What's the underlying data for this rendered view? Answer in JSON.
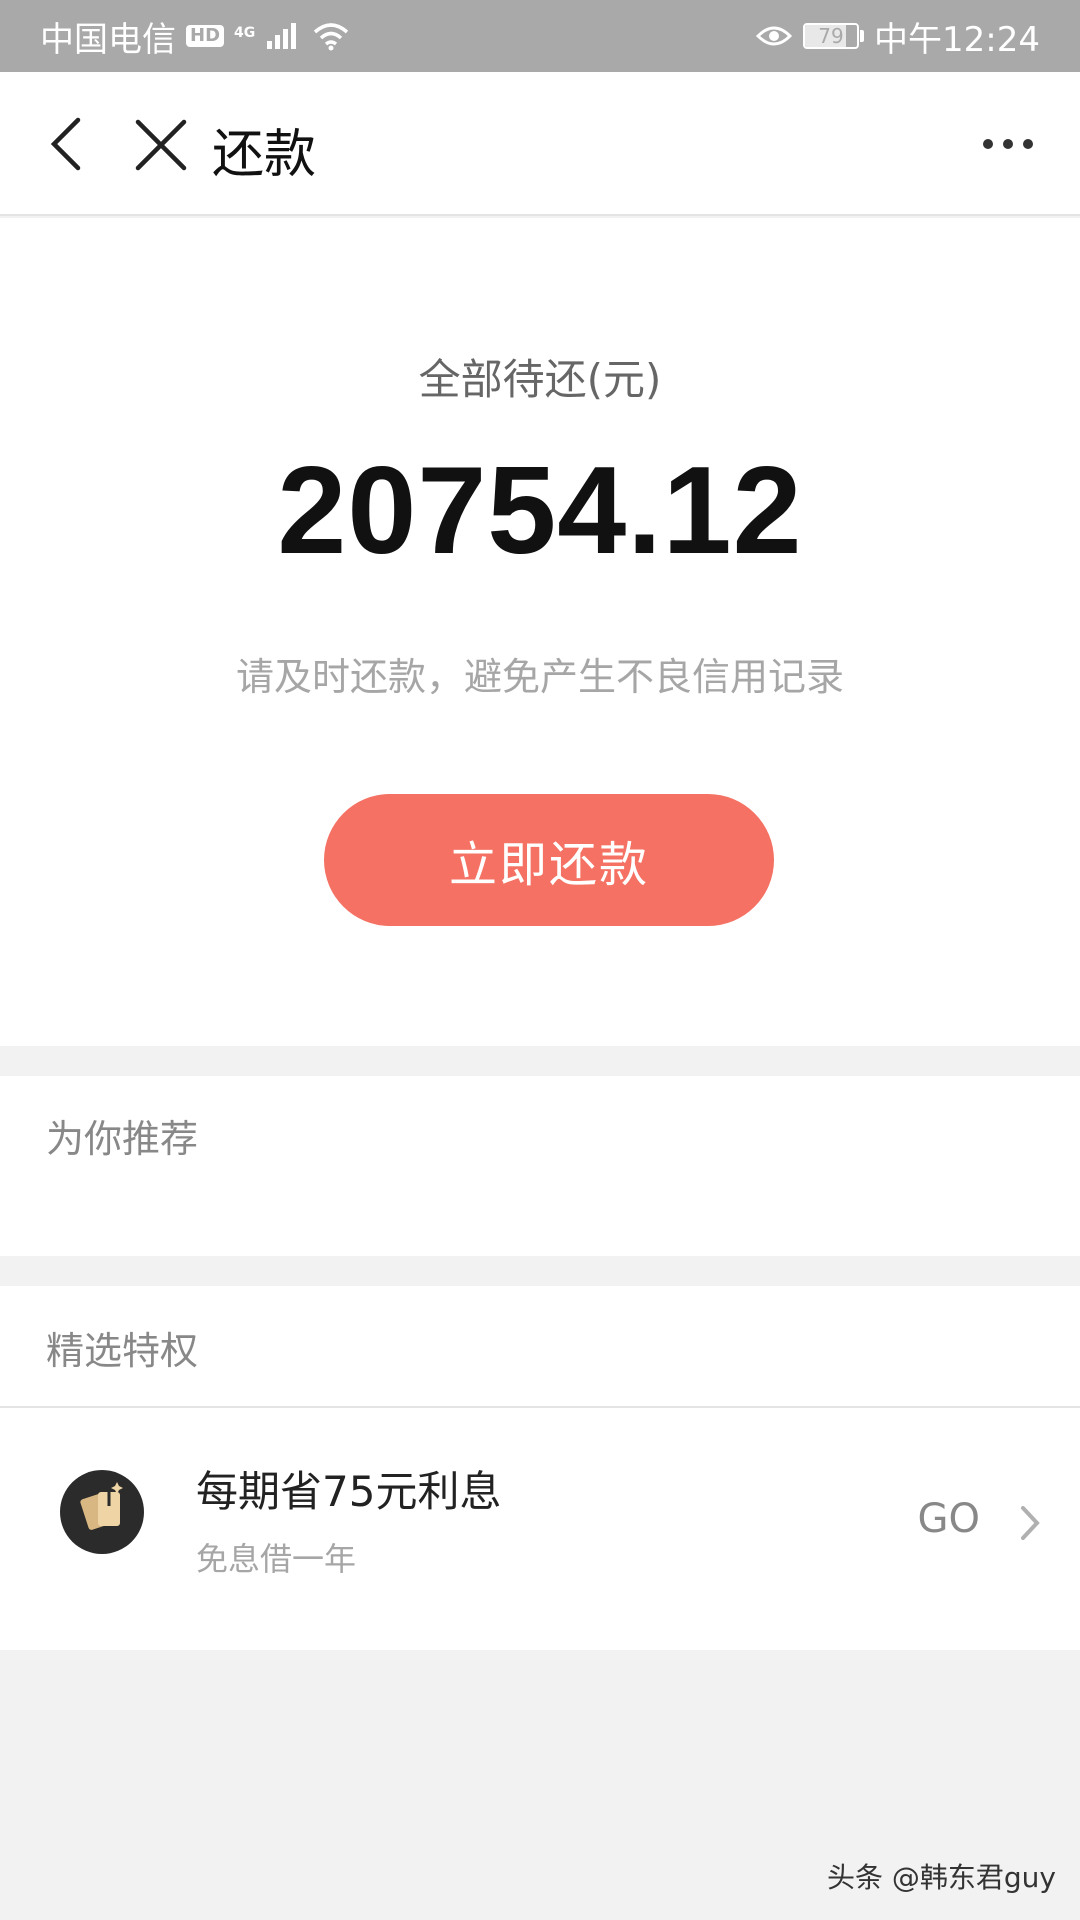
{
  "status_bar": {
    "carrier": "中国电信",
    "hd": "HD",
    "network": "4G",
    "battery": "79",
    "battery_level": 0.79,
    "time": "中午12:24"
  },
  "nav": {
    "title": "还款"
  },
  "hero": {
    "label": "全部待还(元)",
    "amount": "20754.12",
    "tip": "请及时还款，避免产生不良信用记录",
    "button": "立即还款"
  },
  "recommend": {
    "title": "为你推荐"
  },
  "privilege": {
    "title": "精选特权",
    "item": {
      "title": "每期省75元利息",
      "subtitle": "免息借一年",
      "action": "GO"
    }
  },
  "watermark": "头条 @韩东君guy",
  "colors": {
    "accent": "#f47163",
    "status_bar": "#a9a9a9",
    "page_bg": "#f2f2f2"
  }
}
